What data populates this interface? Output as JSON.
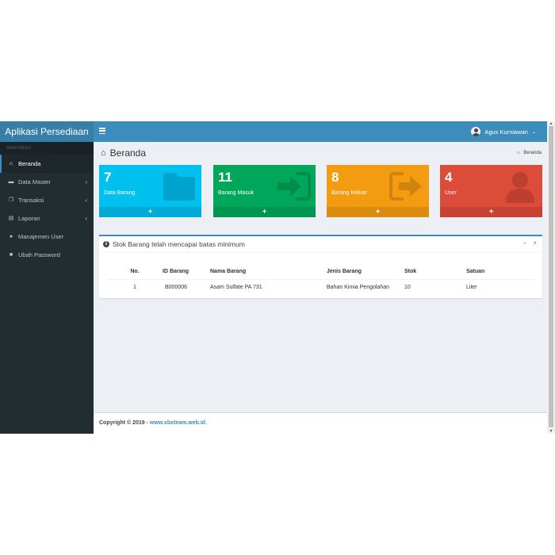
{
  "app": {
    "title": "Aplikasi Persediaan"
  },
  "navbar": {
    "user_name": "Agus Kurniawan",
    "caret": "⌄"
  },
  "sidebar": {
    "header": "MAIN MENU",
    "items": [
      {
        "label": "Beranda",
        "icon": "home-icon",
        "glyph": "⌂"
      },
      {
        "label": "Data Master",
        "icon": "folder-icon",
        "glyph": "▬",
        "caret": "‹"
      },
      {
        "label": "Transaksi",
        "icon": "clone-icon",
        "glyph": "❐",
        "caret": "‹"
      },
      {
        "label": "Laporan",
        "icon": "file-icon",
        "glyph": "▤",
        "caret": "‹"
      },
      {
        "label": "Manajemen User",
        "icon": "user-icon",
        "glyph": "●"
      },
      {
        "label": "Ubah Password",
        "icon": "lock-icon",
        "glyph": "■"
      }
    ]
  },
  "page": {
    "title": "Beranda",
    "breadcrumb": "Beranda"
  },
  "boxes": [
    {
      "count": "7",
      "label": "Data Barang",
      "color": "#00c0ef",
      "icon": "folder-icon"
    },
    {
      "count": "11",
      "label": "Barang Masuk",
      "color": "#00a65a",
      "icon": "sign-in-icon"
    },
    {
      "count": "8",
      "label": "Barang Keluar",
      "color": "#f39c12",
      "icon": "share-icon"
    },
    {
      "count": "4",
      "label": "User",
      "color": "#dd4b39",
      "icon": "user-icon"
    }
  ],
  "box_footer": "+",
  "panel": {
    "title": "Stok Barang telah mencapai batas minimum",
    "info": "i",
    "minimize": "−",
    "close": "×",
    "columns": [
      "No.",
      "ID Barang",
      "Nama Barang",
      "Jenis Barang",
      "Stok",
      "Satuan"
    ],
    "rows": [
      [
        "1",
        "B000006",
        "Asam Sulfate PA 731",
        "Bahan Kimia Pengolahan",
        "10",
        "Liter"
      ]
    ]
  },
  "footer": {
    "copyright": "Copyright © 2019 -",
    "link": "www.xbxteam.web.id",
    "end": "."
  },
  "scrollbar": {
    "up": "▲",
    "down": "▼"
  }
}
